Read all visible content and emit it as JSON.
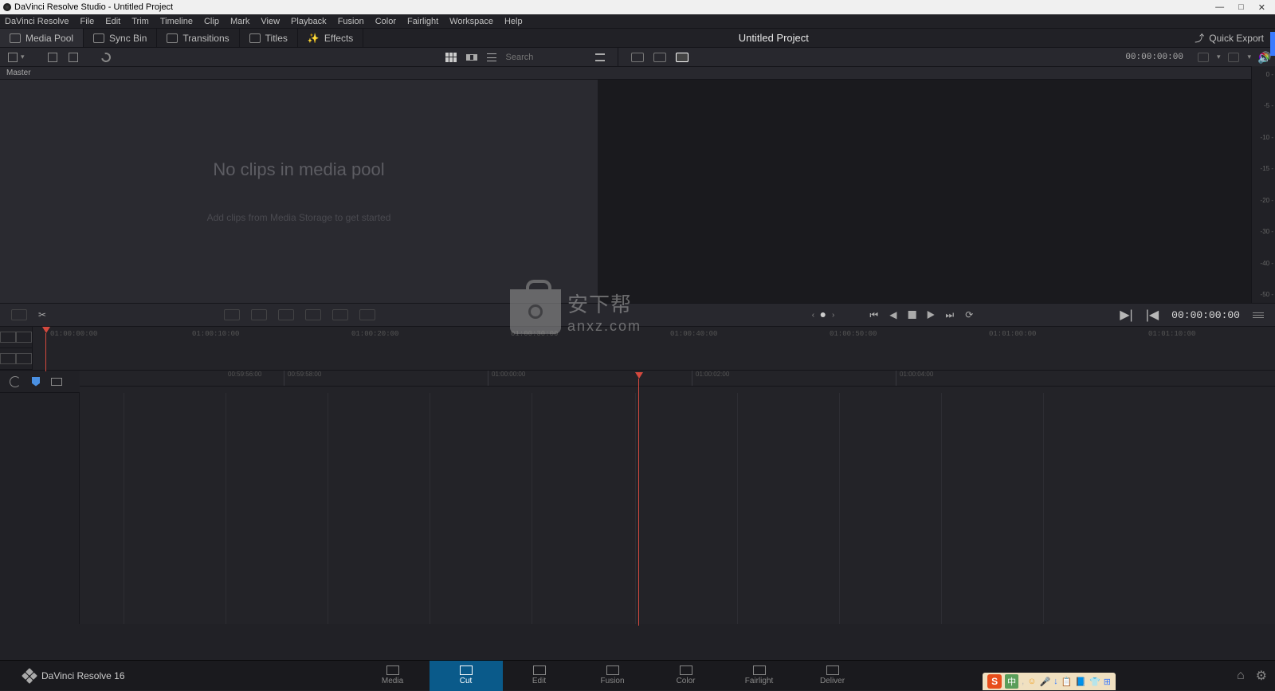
{
  "titlebar": {
    "title": "DaVinci Resolve Studio - Untitled Project"
  },
  "menubar": [
    "DaVinci Resolve",
    "File",
    "Edit",
    "Trim",
    "Timeline",
    "Clip",
    "Mark",
    "View",
    "Playback",
    "Fusion",
    "Color",
    "Fairlight",
    "Workspace",
    "Help"
  ],
  "tabbar": {
    "media_pool": "Media Pool",
    "sync_bin": "Sync Bin",
    "transitions": "Transitions",
    "titles": "Titles",
    "effects": "Effects",
    "center_title": "Untitled Project",
    "quick_export": "Quick Export"
  },
  "toolbar": {
    "search_placeholder": "Search",
    "timecode": "00:00:00:00"
  },
  "master_label": "Master",
  "media_pool": {
    "empty_title": "No clips in media pool",
    "empty_sub": "Add clips from Media Storage to get started"
  },
  "meter_labels": [
    "0 -",
    "-5 -",
    "-10 -",
    "-15 -",
    "-20 -",
    "-30 -",
    "-40 -",
    "-50 -"
  ],
  "playbar": {
    "timecode": "00:00:00:00"
  },
  "ruler1_labels": [
    "01:00:00:00",
    "01:00:10:00",
    "01:00:20:00",
    "01:00:30:00",
    "01:00:40:00",
    "01:00:50:00",
    "01:01:00:00",
    "01:01:10:00"
  ],
  "ruler2_labels": [
    "00:59:56:00",
    "00:59:58:00",
    "01:00:00:00",
    "01:00:02:00",
    "01:00:04:00"
  ],
  "watermark": {
    "text_top": "安下帮",
    "text_bottom": "anxz.com"
  },
  "pages": [
    {
      "label": "Media",
      "active": false
    },
    {
      "label": "Cut",
      "active": true
    },
    {
      "label": "Edit",
      "active": false
    },
    {
      "label": "Fusion",
      "active": false
    },
    {
      "label": "Color",
      "active": false
    },
    {
      "label": "Fairlight",
      "active": false
    },
    {
      "label": "Deliver",
      "active": false
    }
  ],
  "brand": "DaVinci Resolve 16",
  "tray_items": [
    "中",
    ",",
    "☺",
    "🎤",
    "↓",
    "📋",
    "📘",
    "👕",
    "⊞"
  ]
}
